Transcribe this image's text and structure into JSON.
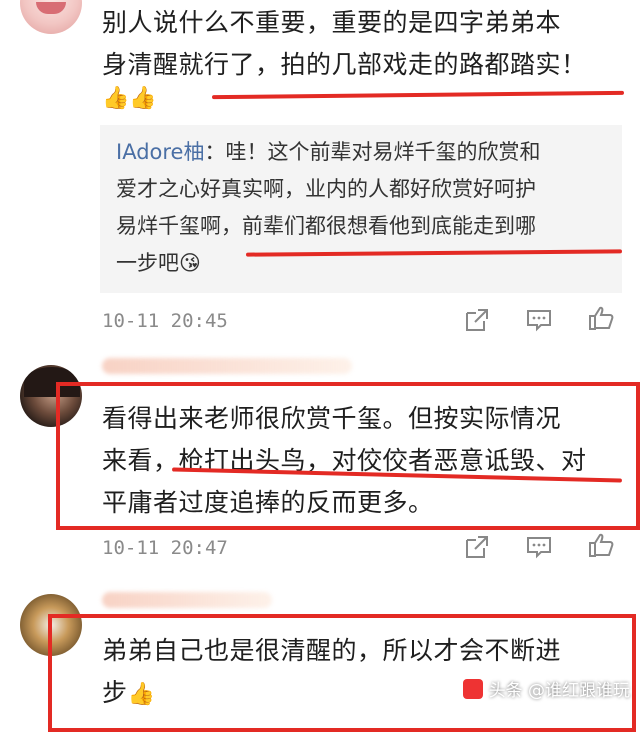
{
  "comment1": {
    "text_line1": "别人说什么不重要，重要的是四字弟弟本",
    "text_line2": "身清醒就行了，拍的几部戏走的路都踏实！",
    "emoji": "👍👍",
    "reply_user": "IAdore柚",
    "reply_text_line1": "：哇！这个前辈对易烊千玺的欣赏和",
    "reply_text_line2": "爱才之心好真实啊，业内的人都好欣赏好呵护",
    "reply_text_line3": "易烊千玺啊，前辈们都很想看他到底能走到哪",
    "reply_text_line4": "一步吧",
    "reply_emoji": "😘",
    "timestamp": "10-11 20:45"
  },
  "comment2": {
    "text_line1": "看得出来老师很欣赏千玺。但按实际情况",
    "text_line2": "来看，枪打出头鸟，对佼佼者恶意诋毁、对",
    "text_line3": "平庸者过度追捧的反而更多。",
    "timestamp": "10-11 20:47"
  },
  "comment3": {
    "text_line1": "弟弟自己也是很清醒的，所以才会不断进",
    "text_line2": "步",
    "emoji": "👍"
  },
  "watermark": {
    "text": "头条 @谁红跟谁玩"
  },
  "colors": {
    "accent_red": "#e32a24",
    "reply_name": "#4a6fa5"
  }
}
